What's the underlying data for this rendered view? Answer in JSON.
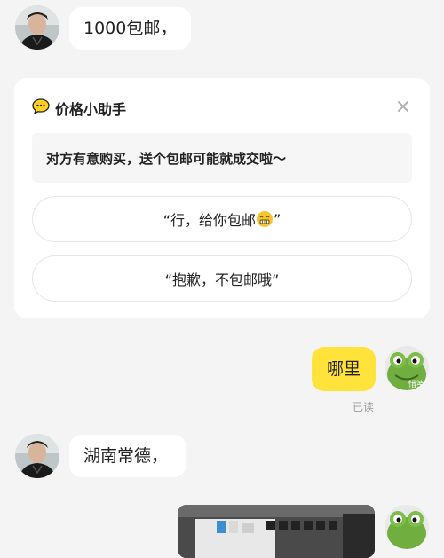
{
  "messages": [
    {
      "sender": "other",
      "text": "1000包邮，"
    },
    {
      "sender": "self",
      "text": "哪里",
      "status": "已读"
    },
    {
      "sender": "other",
      "text": "湖南常德，"
    }
  ],
  "price_helper": {
    "title": "价格小助手",
    "tip": "对方有意购买，送个包邮可能就成交啦～",
    "option_accept": "“行，给你包邮",
    "option_accept_close": "”",
    "option_decline": "“抱歉，不包邮哦”"
  },
  "self_avatar_overlay": "惜笺",
  "colors": {
    "background": "#f4f4f4",
    "self_bubble": "#ffe23a",
    "other_bubble": "#ffffff"
  }
}
